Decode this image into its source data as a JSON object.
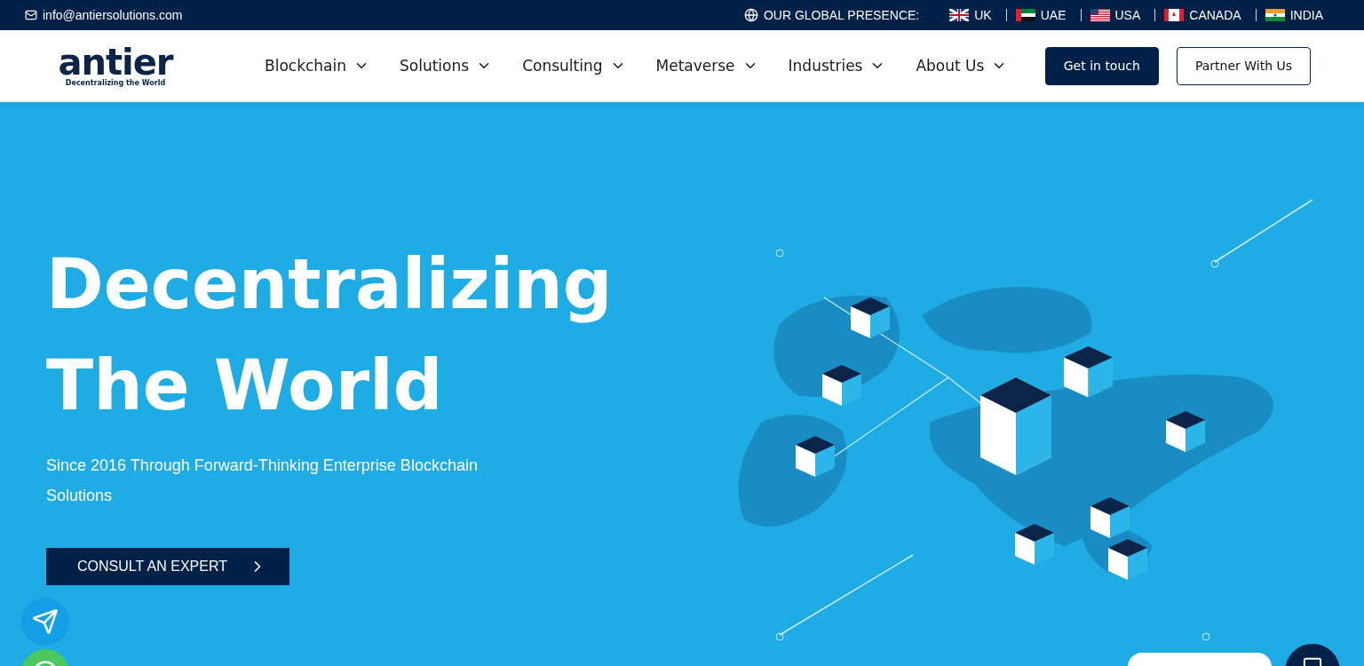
{
  "top_bar": {
    "email": "info@antiersolutions.com",
    "presence_label": "OUR GLOBAL PRESENCE:",
    "locations": [
      {
        "name": "UK"
      },
      {
        "name": "UAE"
      },
      {
        "name": "USA"
      },
      {
        "name": "CANADA"
      },
      {
        "name": "INDIA"
      }
    ]
  },
  "nav": {
    "logo": "antier",
    "tagline": "Decentralizing the World",
    "items": [
      {
        "label": "Blockchain"
      },
      {
        "label": "Solutions"
      },
      {
        "label": "Consulting"
      },
      {
        "label": "Metaverse"
      },
      {
        "label": "Industries"
      },
      {
        "label": "About Us"
      }
    ],
    "buttons": [
      {
        "label": "Get in touch",
        "kind": "primary"
      },
      {
        "label": "Partner With Us",
        "kind": "outline"
      }
    ]
  },
  "hero": {
    "title_lines": [
      "Decentralizing",
      "The World"
    ],
    "subtitle": "Since 2016 Through Forward-Thinking Enterprise Blockchain Solutions",
    "cta": "CONSULT AN EXPERT"
  }
}
